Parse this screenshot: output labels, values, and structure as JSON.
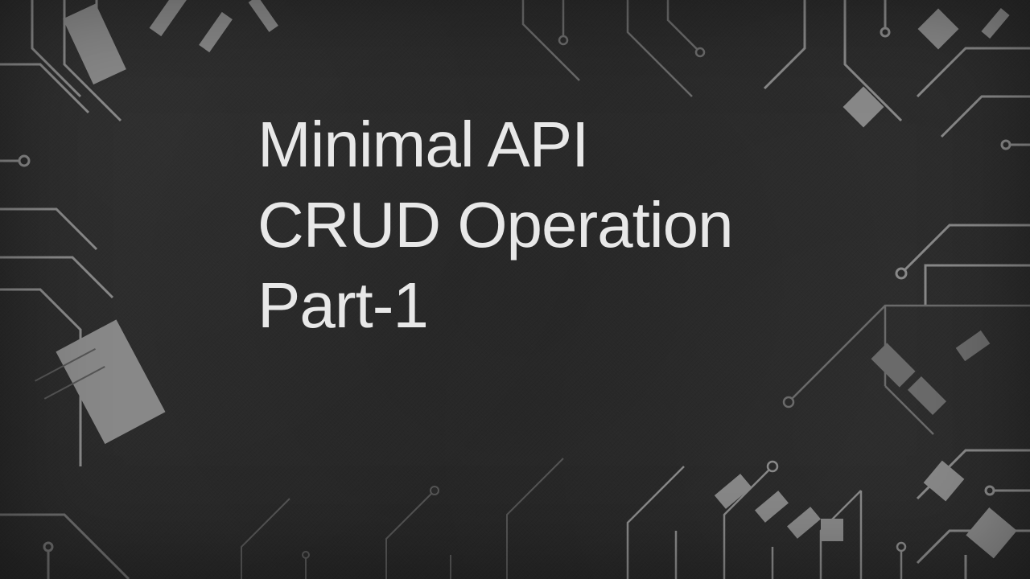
{
  "title": {
    "line1": "Minimal API",
    "line2": "CRUD Operation",
    "line3": "Part-1"
  },
  "colors": {
    "background": "#2a2a2a",
    "circuit_light": "#8a8a8a",
    "circuit_dark": "#565656",
    "text": "#e8e8e8"
  }
}
